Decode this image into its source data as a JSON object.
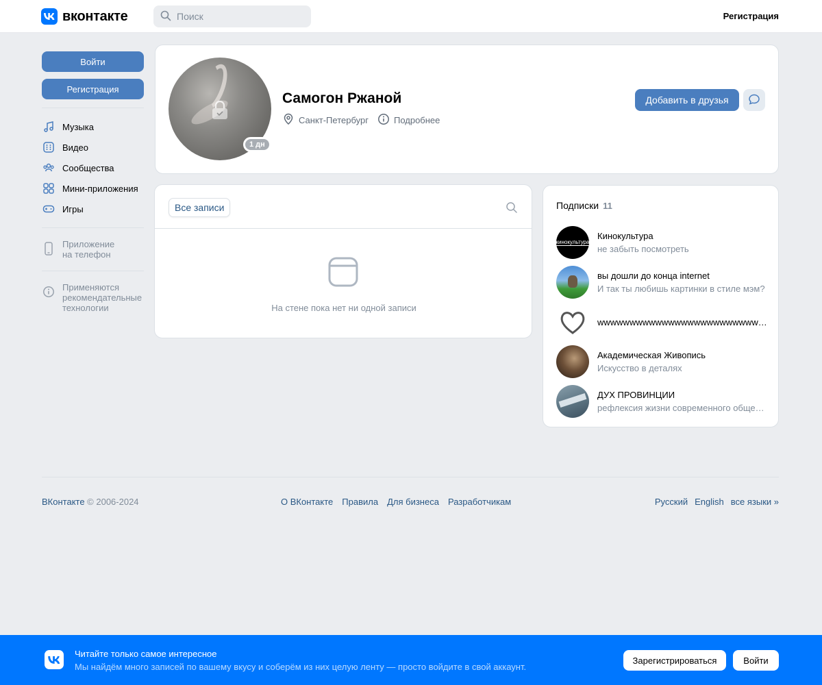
{
  "header": {
    "logo_text": "вконтакте",
    "search_placeholder": "Поиск",
    "register_link": "Регистрация"
  },
  "sidebar": {
    "login_button": "Войти",
    "register_button": "Регистрация",
    "nav": [
      {
        "label": "Музыка",
        "icon": "music-icon"
      },
      {
        "label": "Видео",
        "icon": "video-icon"
      },
      {
        "label": "Сообщества",
        "icon": "communities-icon"
      },
      {
        "label": "Мини-приложения",
        "icon": "mini-apps-icon"
      },
      {
        "label": "Игры",
        "icon": "gamepad-icon"
      }
    ],
    "app_line1": "Приложение",
    "app_line2": "на телефон",
    "rec_line1": "Применяются",
    "rec_line2": "рекомендательные",
    "rec_line3": "технологии"
  },
  "profile": {
    "name": "Самогон Ржаной",
    "online": "1 дн",
    "city": "Санкт-Петербург",
    "more": "Подробнее",
    "add_friend": "Добавить в друзья"
  },
  "wall": {
    "tab": "Все записи",
    "empty": "На стене пока нет ни одной записи"
  },
  "subscriptions": {
    "title": "Подписки",
    "count": "11",
    "items": [
      {
        "name": "Кинокультура",
        "desc": "не забыть посмотреть",
        "avatar_text": "кинокультура"
      },
      {
        "name": "вы дошли до конца internet",
        "desc": "И так ты любишь картинки в стиле мэм?"
      },
      {
        "name": "wwwwwwwwwwwwwwwwwwwwwwwwwwwwwwwwwwww",
        "desc": ""
      },
      {
        "name": "Академическая Живопись",
        "desc": "Искусство в деталях"
      },
      {
        "name": "ДУХ ПРОВИНЦИИ",
        "desc": "рефлексия жизни современного общества"
      }
    ]
  },
  "footer": {
    "brand": "ВКонтакте",
    "copyright": " © 2006-2024",
    "links": [
      "О ВКонтакте",
      "Правила",
      "Для бизнеса",
      "Разработчикам"
    ],
    "langs": [
      "Русский",
      "English",
      "все языки »"
    ]
  },
  "banner": {
    "title": "Читайте только самое интересное",
    "subtitle": "Мы найдём много записей по вашему вкусу и соберём из них целую ленту — просто войдите в свой аккаунт.",
    "register_button": "Зарегистрироваться",
    "login_button": "Войти"
  },
  "colors": {
    "brand_blue": "#0077ff",
    "button_blue": "#4a7ebf",
    "link": "#2a5885",
    "secondary_text": "#818c99",
    "page_bg": "#ebedf0"
  }
}
